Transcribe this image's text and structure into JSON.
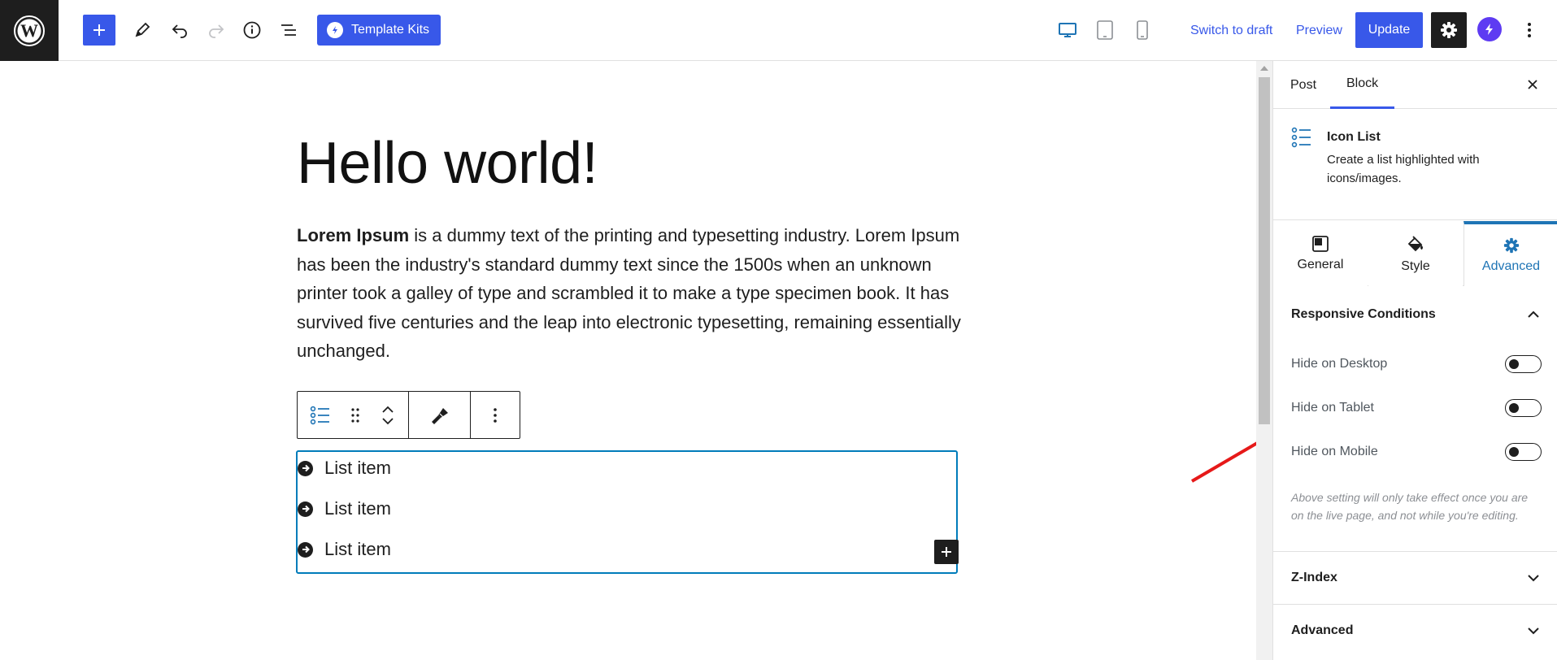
{
  "topbar": {
    "template_kits_label": "Template Kits",
    "switch_to_draft_label": "Switch to draft",
    "preview_label": "Preview",
    "update_label": "Update",
    "accent_color": "#3858e9"
  },
  "editor": {
    "title": "Hello world!",
    "paragraph_bold": "Lorem Ipsum",
    "paragraph_rest": " is a dummy text of the printing and typesetting industry. Lorem Ipsum has been the industry's standard dummy text since the 1500s when an unknown printer took a galley of type and scrambled it to make a type specimen book. It has survived five centuries and the leap into electronic typesetting, remaining essentially unchanged.",
    "list_items": [
      "List item",
      "List item",
      "List item"
    ]
  },
  "sidebar": {
    "tabs": [
      {
        "label": "Post",
        "active": false
      },
      {
        "label": "Block",
        "active": true
      }
    ],
    "block_card": {
      "title": "Icon List",
      "description": "Create a list highlighted with icons/images."
    },
    "panel_tabs": [
      {
        "label": "General",
        "icon": "layout-icon",
        "active": false
      },
      {
        "label": "Style",
        "icon": "paint-bucket-icon",
        "active": false
      },
      {
        "label": "Advanced",
        "icon": "gear-icon",
        "active": true
      }
    ],
    "responsive_conditions": {
      "title": "Responsive Conditions",
      "expanded": true,
      "toggles": [
        {
          "label": "Hide on Desktop",
          "on": false
        },
        {
          "label": "Hide on Tablet",
          "on": false
        },
        {
          "label": "Hide on Mobile",
          "on": false
        }
      ],
      "help_text": "Above setting will only take effect once you are on the live page, and not while you're editing."
    },
    "sections": [
      {
        "title": "Z-Index",
        "expanded": false
      },
      {
        "title": "Advanced",
        "expanded": false
      }
    ]
  }
}
